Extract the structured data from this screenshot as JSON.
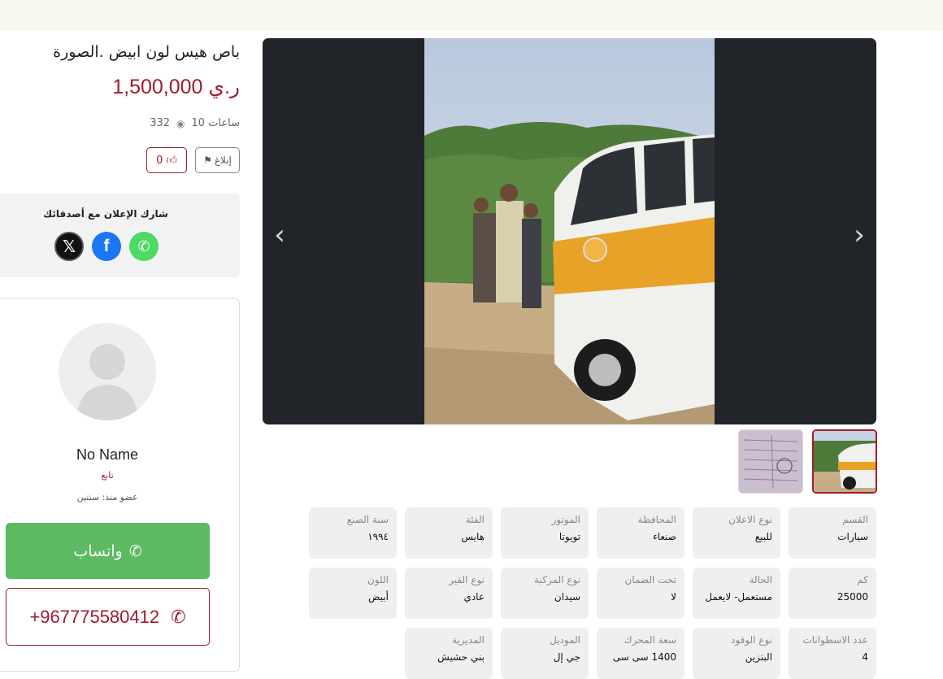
{
  "listing": {
    "title": "باص هيس لون ابيض .الصورة",
    "price": "1,500,000 ر.ي",
    "time_ago": "10 ساعات",
    "views": "332",
    "likes": "0",
    "report_label": "إبلاغ"
  },
  "share": {
    "title": "شارك الإعلان مع أصدقائك",
    "networks": [
      "x-icon",
      "facebook-icon",
      "whatsapp-icon"
    ]
  },
  "seller": {
    "name": "No Name",
    "role": "تابع",
    "member_since": "عضو منذ: سنتين",
    "whatsapp_label": "واتساب",
    "phone": "+967775580412"
  },
  "specs": [
    {
      "label": "القسم",
      "value": "سيارات"
    },
    {
      "label": "نوع الاعلان",
      "value": "للبيع"
    },
    {
      "label": "المحافظة",
      "value": "صنعاء"
    },
    {
      "label": "الموتور",
      "value": "تويوتا"
    },
    {
      "label": "الفئة",
      "value": "هايس"
    },
    {
      "label": "سنة الصنع",
      "value": "١٩٩٤"
    },
    {
      "label": "كم",
      "value": "25000"
    },
    {
      "label": "الحالة",
      "value": "مستعمل- لايعمل"
    },
    {
      "label": "تحت الضمان",
      "value": "لا"
    },
    {
      "label": "نوع المركبة",
      "value": "سيدان"
    },
    {
      "label": "نوع القير",
      "value": "عادي"
    },
    {
      "label": "اللون",
      "value": "أبيض"
    },
    {
      "label": "عدد الاسطوانات",
      "value": "4"
    },
    {
      "label": "نوع الوقود",
      "value": "البنزين"
    },
    {
      "label": "سعة المحرك",
      "value": "1400 سى سى"
    },
    {
      "label": "الموديل",
      "value": "جي إل"
    },
    {
      "label": "المديرية",
      "value": "بني حشيش"
    }
  ],
  "colors": {
    "accent": "#a01c2c",
    "whatsapp": "#5cba63",
    "gallery_bg": "#212428",
    "card_bg": "#efefef"
  }
}
